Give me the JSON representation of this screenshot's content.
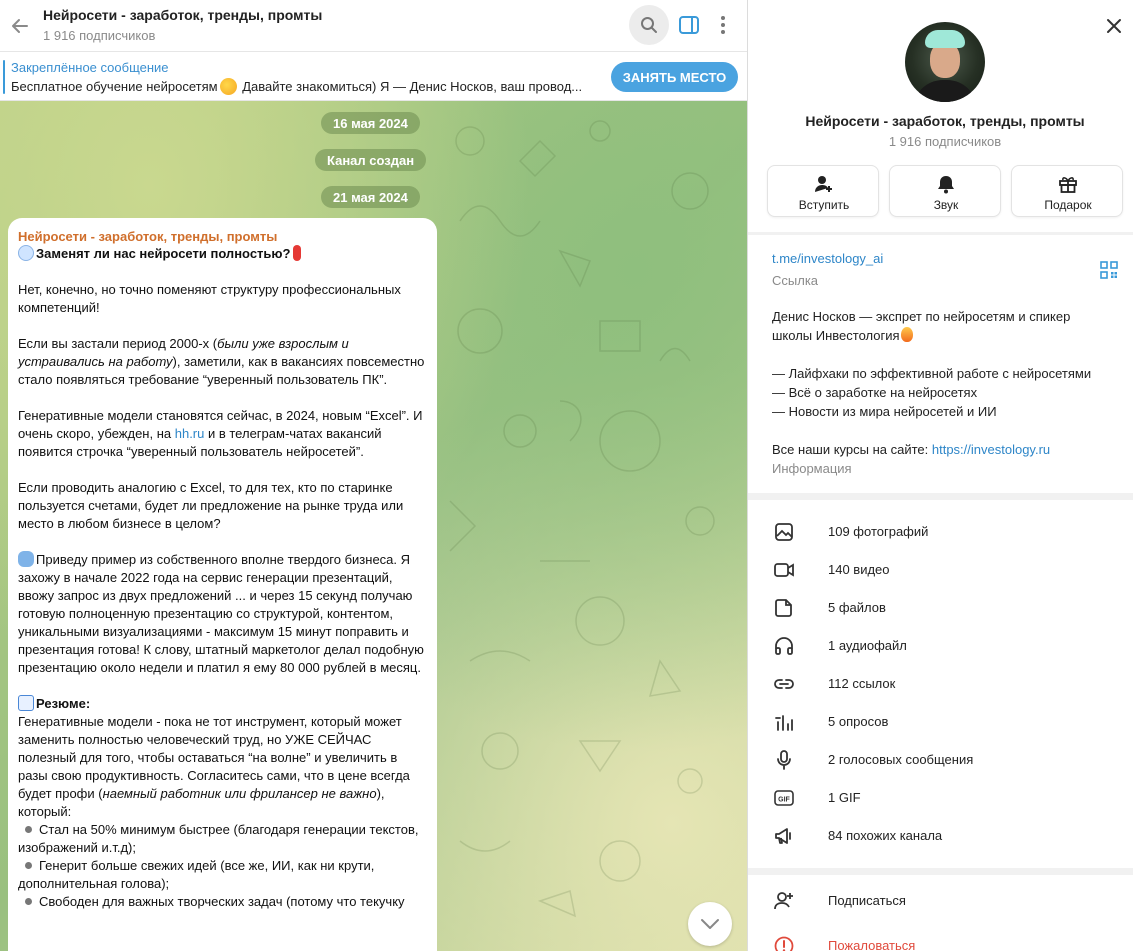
{
  "header": {
    "title": "Нейросети - заработок, тренды, промты",
    "subscribers": "1 916 подписчиков"
  },
  "pinned": {
    "title": "Закреплённое сообщение",
    "text_before": "Бесплатное обучение нейросетям",
    "text_after": "Давайте знакомиться) Я — Денис Носков, ваш провод..."
  },
  "join_button": "ЗАНЯТЬ МЕСТО",
  "dates": {
    "d1": "16 мая 2024",
    "service": "Канал создан",
    "d2": "21 мая 2024"
  },
  "message": {
    "author": "Нейросети - заработок, тренды, промты",
    "heading": "Заменят ли нас нейросети полностью?",
    "p1": "Нет, конечно, но точно поменяют структуру профессиональных компетенций!",
    "p2_a": "Если вы застали период 2000-х (",
    "p2_italic": "были уже взрослым и устраивались на работу",
    "p2_b": "), заметили, как в вакансиях повсеместно стало появляться требование “уверенный пользователь ПК”.",
    "p3_a": "Генеративные модели становятся сейчас, в 2024, новым “Excel”. И очень скоро, убежден, на ",
    "p3_link": "hh.ru",
    "p3_b": " и в телеграм-чатах вакансий появится строчка “уверенный пользователь нейросетей”.",
    "p4": "Если проводить аналогию с Excel, то для тех, кто по старинке пользуется счетами, будет ли предложение на рынке труда или место в любом бизнесе в целом?",
    "p5": "Приведу пример из собственного вполне твердого бизнеса. Я захожу в начале 2022 года на сервис генерации презентаций, ввожу запрос из двух предложений ... и через 15 секунд получаю готовую полноценную презентацию со структурой, контентом, уникальными визуализациями - максимум 15 минут поправить и презентация готова! К слову, штатный маркетолог делал подобную презентацию около недели и платил я ему 80 000 рублей в месяц.",
    "summary_title": "Резюме:",
    "p6_a": "Генеративные модели - пока не тот инструмент, который может заменить полностью человеческий труд, но УЖЕ СЕЙЧАС полезный для того, чтобы оставаться “на волне” и увеличить в разы свою продуктивность. Согласитесь сами, что в цене всегда будет профи (",
    "p6_italic": "наемный работник или фрилансер не важно",
    "p6_b": "), который:",
    "bullets": [
      "Стал на 50% минимум быстрее (благодаря генерации текстов, изображений и.т.д);",
      "Генерит больше свежих идей (все же, ИИ, как ни крути, дополнительная голова);",
      "Свободен для важных творческих задач (потому что текучку"
    ]
  },
  "profile": {
    "name": "Нейросети - заработок, тренды, промты",
    "subscribers": "1 916 подписчиков",
    "actions": [
      "Вступить",
      "Звук",
      "Подарок"
    ],
    "link": "t.me/investology_ai",
    "link_label": "Ссылка",
    "desc_line1": "Денис Носков — экспрет по нейросетям и спикер школы Инвестология",
    "desc_items": [
      "— Лайфхаки по эффективной работе с нейросетями",
      "— Всё о заработке на нейросетях",
      "— Новости из мира нейросетей и ИИ"
    ],
    "desc_courses": "Все наши курсы на сайте: ",
    "desc_courses_link": "https://investology.ru",
    "desc_label": "Информация"
  },
  "media": [
    {
      "icon": "photo-icon",
      "label": "109 фотографий"
    },
    {
      "icon": "video-icon",
      "label": "140 видео"
    },
    {
      "icon": "file-icon",
      "label": "5 файлов"
    },
    {
      "icon": "headphones-icon",
      "label": "1 аудиофайл"
    },
    {
      "icon": "link-icon",
      "label": "112 ссылок"
    },
    {
      "icon": "poll-icon",
      "label": "5 опросов"
    },
    {
      "icon": "mic-icon",
      "label": "2 голосовых сообщения"
    },
    {
      "icon": "gif-icon",
      "label": "1 GIF"
    },
    {
      "icon": "megaphone-icon",
      "label": "84 похожих канала"
    }
  ],
  "bottom_actions": {
    "subscribe": "Подписаться",
    "report": "Пожаловаться"
  },
  "colors": {
    "accent": "#3a9ad9",
    "author": "#d06f2c",
    "link": "#2e86c8",
    "danger": "#e04a3c"
  }
}
